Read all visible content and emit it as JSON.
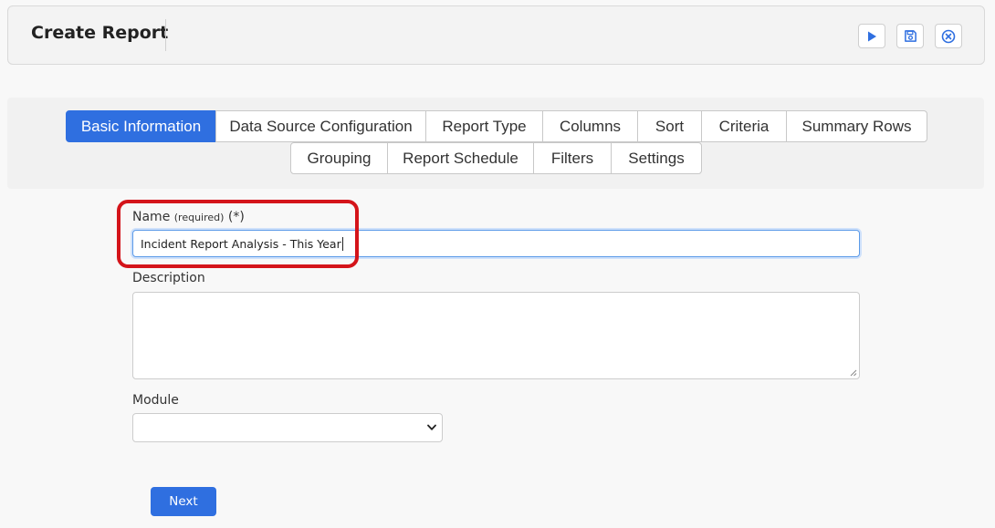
{
  "header": {
    "title": "Create Report",
    "actions": [
      {
        "name": "run",
        "icon": "play-icon"
      },
      {
        "name": "save",
        "icon": "floppy-disk-icon"
      },
      {
        "name": "close",
        "icon": "close-circle-icon"
      }
    ]
  },
  "tabs": {
    "row1": [
      {
        "label": "Basic Information",
        "active": true
      },
      {
        "label": "Data Source Configuration",
        "active": false
      },
      {
        "label": "Report Type",
        "active": false
      },
      {
        "label": "Columns",
        "active": false
      },
      {
        "label": "Sort",
        "active": false
      },
      {
        "label": "Criteria",
        "active": false
      },
      {
        "label": "Summary Rows",
        "active": false
      }
    ],
    "row2": [
      {
        "label": "Grouping",
        "active": false
      },
      {
        "label": "Report Schedule",
        "active": false
      },
      {
        "label": "Filters",
        "active": false
      },
      {
        "label": "Settings",
        "active": false
      }
    ]
  },
  "form": {
    "name_label": "Name",
    "name_required": "(required)",
    "name_asterisk": "(*)",
    "name_value": "Incident Report Analysis - This Year",
    "description_label": "Description",
    "description_value": "",
    "module_label": "Module",
    "module_value": "",
    "next_label": "Next"
  },
  "colors": {
    "accent": "#2f6fe0",
    "highlight": "#d4141a"
  }
}
